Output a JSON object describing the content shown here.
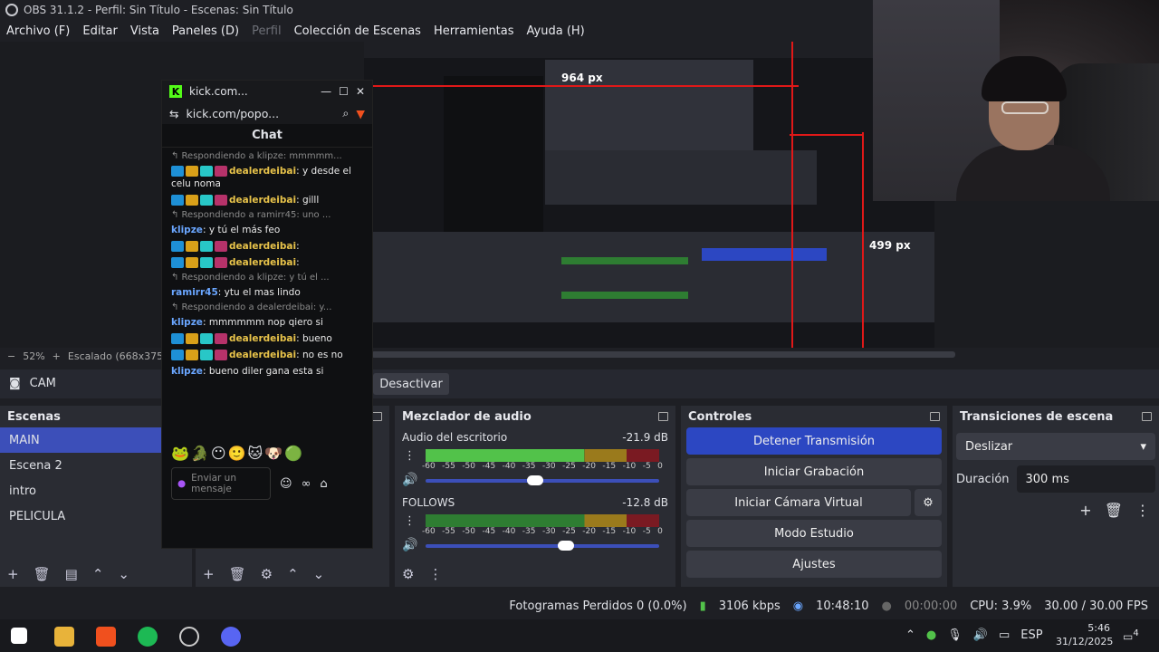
{
  "window": {
    "title": "OBS 31.1.2 - Perfil: Sin Título - Escenas: Sin Título"
  },
  "menu": [
    "Archivo (F)",
    "Editar",
    "Vista",
    "Paneles (D)",
    "Perfil",
    "Colección de Escenas",
    "Herramientas",
    "Ayuda (H)"
  ],
  "preview": {
    "zoom": "52%",
    "scaling": "Escalado (668x375)",
    "label_964": "964 px",
    "label_499": "499 px"
  },
  "source": {
    "name": "CAM",
    "deactivate": "Desactivar"
  },
  "scenes": {
    "title": "Escenas",
    "items": [
      "MAIN",
      "Escena 2",
      "intro",
      "PELICULA"
    ],
    "selected": 0
  },
  "mixer": {
    "title": "Mezclador de audio",
    "channels": [
      {
        "name": "Audio del escritorio",
        "db": "-21.9 dB",
        "level": 0.68,
        "volume": 0.47
      },
      {
        "name": "FOLLOWS",
        "db": "-12.8 dB",
        "level": 0.0,
        "volume": 0.6
      }
    ],
    "scale": [
      "-60",
      "-55",
      "-50",
      "-45",
      "-40",
      "-35",
      "-30",
      "-25",
      "-20",
      "-15",
      "-10",
      "-5",
      "0"
    ]
  },
  "controls": {
    "title": "Controles",
    "stream": "Detener Transmisión",
    "record": "Iniciar Grabación",
    "vcam": "Iniciar Cámara Virtual",
    "studio": "Modo Estudio",
    "settings": "Ajustes"
  },
  "transitions": {
    "title": "Transiciones de escena",
    "selected": "Deslizar",
    "duration_label": "Duración",
    "duration": "300 ms"
  },
  "status": {
    "dropped": "Fotogramas Perdidos 0 (0.0%)",
    "bitrate": "3106 kbps",
    "live": "10:48:10",
    "rec": "00:00:00",
    "cpu": "CPU: 3.9%",
    "fps": "30.00 / 30.00 FPS"
  },
  "chat": {
    "tab": "kick.com...",
    "url": "kick.com/popo...",
    "title": "Chat",
    "messages": [
      {
        "reply": "Respondiendo a klipze: mmmmm...",
        "user": "dealerdeibai",
        "text": ": y desde el celu noma"
      },
      {
        "user": "dealerdeibai",
        "text": ": gilll"
      },
      {
        "reply": "Respondiendo a ramirr45: uno ...",
        "user": "klipze",
        "text": ": y tú el más feo",
        "blue": true
      },
      {
        "user": "dealerdeibai",
        "text": ":"
      },
      {
        "user": "dealerdeibai",
        "text": ":"
      },
      {
        "reply": "Respondiendo a klipze: y tú el ...",
        "user": "ramirr45",
        "text": ": ytu el mas lindo",
        "blue": true
      },
      {
        "reply": "Respondiendo a dealerdeibai: y...",
        "user": "klipze",
        "text": ": mmmmmm nop qiero si",
        "blue": true
      },
      {
        "user": "dealerdeibai",
        "text": ": bueno"
      },
      {
        "user": "dealerdeibai",
        "text": ": no es no"
      },
      {
        "user": "klipze",
        "text": ": bueno diler gana esta si",
        "blue": true
      }
    ],
    "input_placeholder": "Enviar un mensaje"
  },
  "taskbar": {
    "lang": "ESP",
    "time": "5:46",
    "date": "31/12/2025",
    "notif": "4"
  }
}
